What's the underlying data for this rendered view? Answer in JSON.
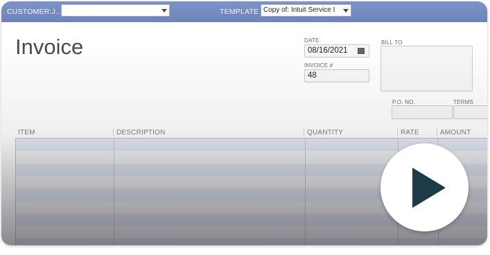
{
  "topbar": {
    "customer_label": "CUSTOMER:J...",
    "customer_value": "",
    "template_label": "TEMPLATE",
    "template_value": "Copy of: Intuit Service I"
  },
  "form": {
    "title": "Invoice",
    "date_label": "DATE",
    "date_value": "08/16/2021",
    "invoice_no_label": "INVOICE #",
    "invoice_no_value": "48",
    "bill_to_label": "BILL TO",
    "po_label": "P.O. NO.",
    "terms_label": "TERMS"
  },
  "table": {
    "columns": [
      "ITEM",
      "DESCRIPTION",
      "QUANTITY",
      "RATE",
      "AMOUNT"
    ]
  },
  "video": {
    "icon": "play-icon"
  }
}
